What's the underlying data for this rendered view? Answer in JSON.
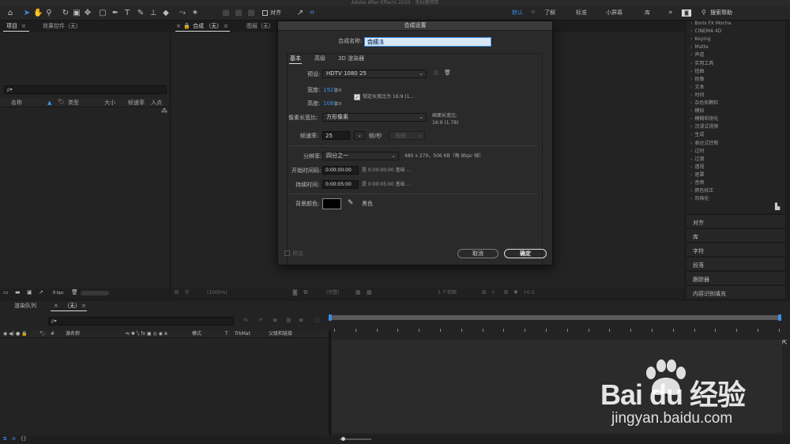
{
  "app": {
    "window_title": "Adobe After Effects 2020 - 无标题项目"
  },
  "toolbar": {
    "snap_label": "对齐",
    "workspaces": [
      "默认",
      "了解",
      "标准",
      "小屏幕",
      "库"
    ],
    "more_label": "»",
    "search_placeholder": "搜索帮助"
  },
  "project_panel": {
    "tab_project": "项目",
    "tab_effect_controls": "效果控件（无）",
    "search_placeholder": "ρ▾",
    "columns": [
      "名称",
      "类型",
      "大小",
      "帧速率",
      "入点"
    ],
    "bpc_label": "8 bpc"
  },
  "comp_panel": {
    "tab_comp": "合成 （无）",
    "tab_layer": "图层（无）",
    "zoom_label": "(1000%)",
    "resolution_label": "(完整)",
    "view_label": "1 个视图",
    "exposure_value": "+0.0"
  },
  "dialog": {
    "title": "合成设置",
    "comp_name_label": "合成名称:",
    "comp_name_value": "合成 1",
    "tabs": [
      "基本",
      "高级",
      "3D 渲染器"
    ],
    "preset_label": "预设:",
    "preset_value": "HDTV 1080 25",
    "width_label": "宽度:",
    "width_value": "1920",
    "height_label": "高度:",
    "height_value": "1080",
    "px_unit": "px",
    "lock_aspect_label": "锁定长宽比为 16:9 (1...",
    "pixel_aspect_label": "像素长宽比:",
    "pixel_aspect_value": "方形像素",
    "frame_aspect_label": "画面长宽比:",
    "frame_aspect_value": "16:9 (1.78)",
    "frame_rate_label": "帧速率:",
    "frame_rate_value": "25",
    "fps_unit": "帧/秒",
    "drop_frame_label": "丢帧",
    "resolution_label": "分辨率:",
    "resolution_value": "四分之一",
    "resolution_info": "480 x 270，506 KB（每 8bpc 帧）",
    "start_tc_label": "开始时间码:",
    "start_tc_value": "0:00:00:00",
    "start_tc_info": "是 0:00:00:00  基础 ...",
    "duration_label": "持续时间:",
    "duration_value": "0:00:05:00",
    "duration_info": "是 0:00:05:00  基础 ...",
    "bg_color_label": "背景颜色:",
    "bg_color_hex": "#000000",
    "bg_color_name": "黑色",
    "preview_label": "预览",
    "cancel_label": "取消",
    "ok_label": "确定"
  },
  "effects_panel": {
    "items": [
      "Boris FX Mocha",
      "CINEMA 4D",
      "Keying",
      "Matte",
      "声道",
      "实用工具",
      "扭曲",
      "抠像",
      "文本",
      "时间",
      "杂色和颗粒",
      "模拟",
      "模糊和锐化",
      "沉浸式视频",
      "生成",
      "表达式控制",
      "过时",
      "过渡",
      "透视",
      "遮罩",
      "音频",
      "颜色校正",
      "风格化"
    ]
  },
  "right_panels": [
    "对齐",
    "库",
    "字符",
    "段落",
    "跟踪器",
    "内容识别填充"
  ],
  "timeline": {
    "tab_render_queue": "渲染队列",
    "tab_comp": "（无）",
    "search_placeholder": "ρ▾",
    "col_source_name": "源名称",
    "col_mode": "模式",
    "col_t": "T",
    "col_trkmat": "TrkMat",
    "col_parent": "父级和链接"
  },
  "watermark": {
    "brand": "Bai du 经验",
    "url": "jingyan.baidu.com"
  },
  "colors": {
    "accent": "#3d8fe5",
    "panel_bg": "#232323",
    "dialog_bg": "#2a2a2a"
  }
}
